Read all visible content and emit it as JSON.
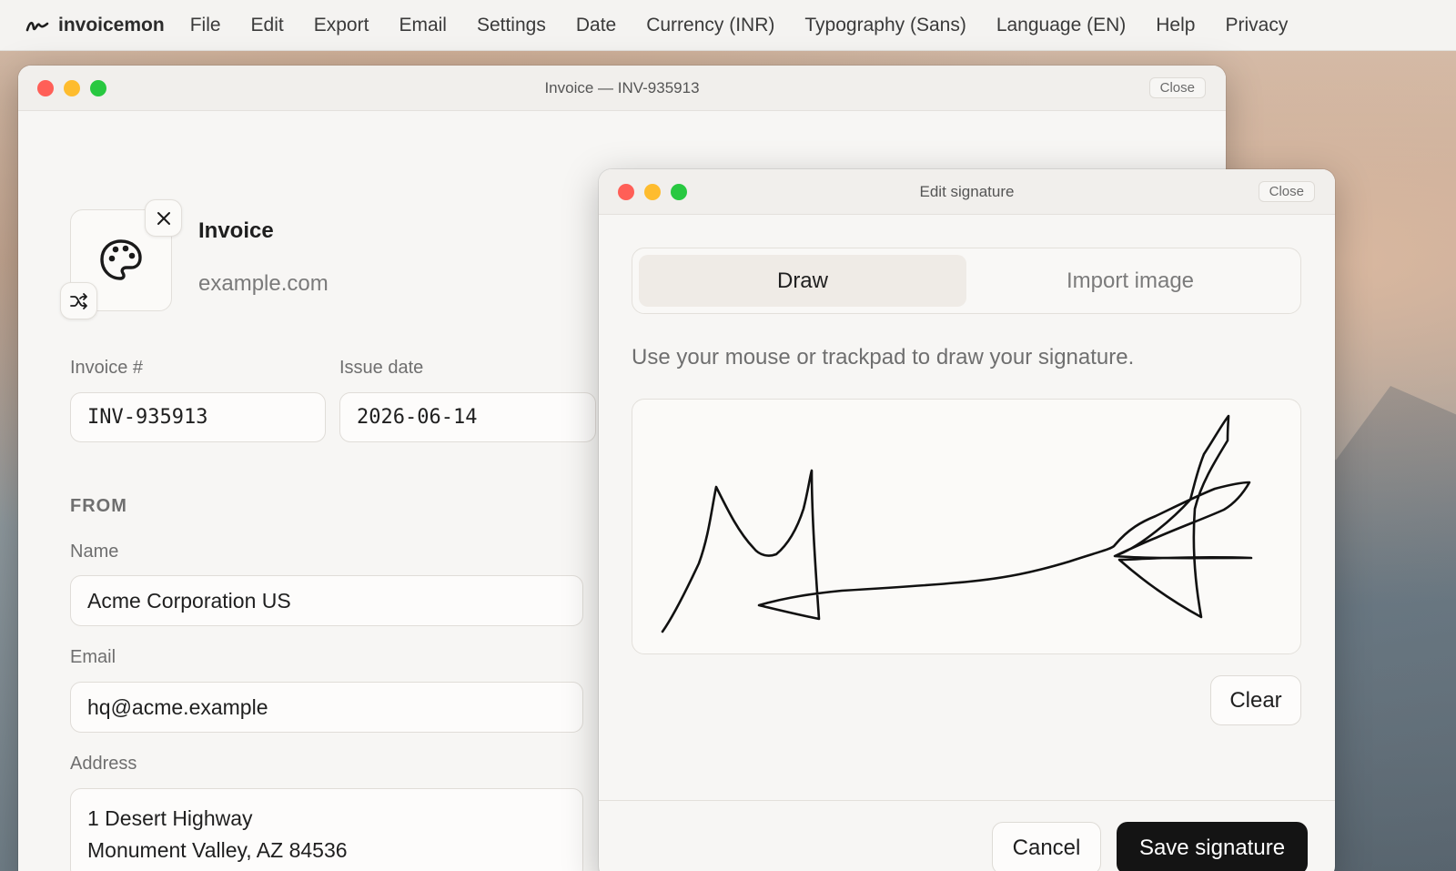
{
  "menubar": {
    "brand": "invoicemon",
    "items": [
      "File",
      "Edit",
      "Export",
      "Email",
      "Settings",
      "Date",
      "Currency (INR)",
      "Typography (Sans)",
      "Language (EN)",
      "Help",
      "Privacy"
    ]
  },
  "invoice_window": {
    "title": "Invoice — INV-935913",
    "close_label": "Close",
    "doc_title": "Invoice",
    "website": "example.com",
    "invoice_number_label": "Invoice #",
    "invoice_number": "INV-935913",
    "issue_date_label": "Issue date",
    "issue_date": "2026-06-14",
    "from_section": "FROM",
    "name_label": "Name",
    "name": "Acme Corporation US",
    "email_label": "Email",
    "email": "hq@acme.example",
    "address_label": "Address",
    "address_line1": "1 Desert Highway",
    "address_line2": "Monument Valley, AZ 84536"
  },
  "signature_dialog": {
    "title": "Edit signature",
    "close_label": "Close",
    "tab_draw": "Draw",
    "tab_import": "Import image",
    "hint": "Use your mouse or trackpad to draw your signature.",
    "clear_label": "Clear",
    "cancel_label": "Cancel",
    "save_label": "Save signature"
  },
  "icons": {
    "brand": "scribble-icon",
    "logo": "palette-icon",
    "remove": "close-icon",
    "shuffle": "shuffle-icon"
  },
  "colors": {
    "close_light": "#ff5f57",
    "minimize_light": "#febc2e",
    "zoom_light": "#28c840",
    "primary_button": "#141414"
  }
}
